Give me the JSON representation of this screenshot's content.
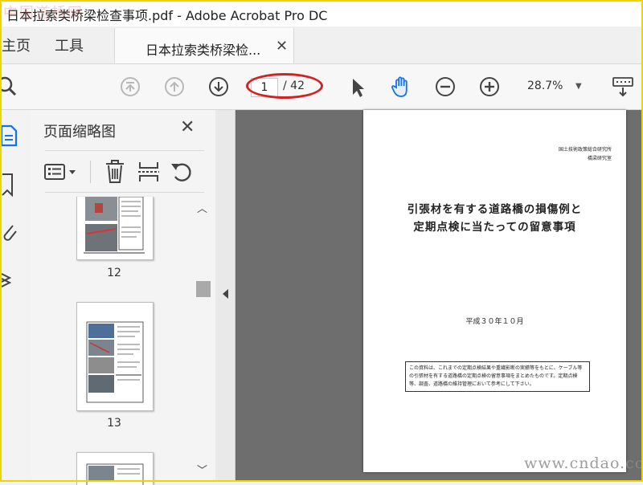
{
  "window": {
    "title": "日本拉索类桥梁检查事项.pdf - Adobe Acrobat Pro DC"
  },
  "tabs": {
    "home": "主页",
    "tools": "工具",
    "document": "日本拉索类桥梁检...",
    "close_symbol": "✕"
  },
  "toolbar": {
    "icons": [
      "search-icon",
      "first-page-icon",
      "prev-page-icon",
      "next-page-icon",
      "select-cursor-icon",
      "hand-tool-icon",
      "zoom-out-icon",
      "zoom-in-icon",
      "keyboard-tools-icon"
    ],
    "current_page": "1",
    "total_pages": "/ 42",
    "zoom": "28.7%"
  },
  "panel": {
    "title": "页面缩略图",
    "close_symbol": "✕",
    "thumbnails": [
      {
        "label": "12"
      },
      {
        "label": "13"
      }
    ]
  },
  "document": {
    "org_line1": "国土技術政策総合研究所",
    "org_line2": "橋梁研究室",
    "title_line1": "引張材を有する道路橋の損傷例と",
    "title_line2": "定期点検に当たっての留意事項",
    "date": "平成３０年１０月",
    "note": "この資料は、これまでの定期点検結果や重繊影断の実績等をもとに、ケーブル等の引張材を有する道路橋の定期点検の留意事項をまとめたものです。定期点検等、調査、道路橋の維持管理において参考にして下さい。"
  },
  "watermarks": {
    "top_left": "中国道桥网",
    "bottom_right": "www.cndao.com"
  },
  "colors": {
    "accent_blue": "#1473e6",
    "highlight_ellipse": "#d32222",
    "window_border": "#f0d400",
    "canvas_bg": "#6e6e6e"
  }
}
